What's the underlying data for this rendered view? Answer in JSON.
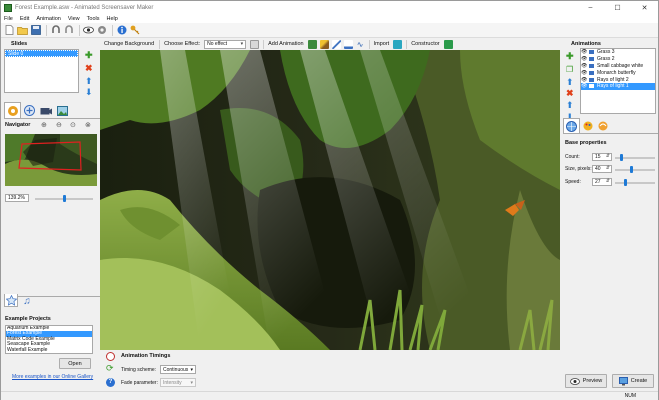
{
  "window": {
    "title": "Forest Example.asw - Animated Screensaver Maker",
    "min": "–",
    "max": "☐",
    "close": "✕"
  },
  "menu": [
    "File",
    "Edit",
    "Animation",
    "View",
    "Tools",
    "Help"
  ],
  "action_bar": {
    "change_background": "Change Background",
    "choose_effect_label": "Choose Effect:",
    "effect_value": "No effect",
    "add_animation": "Add Animation",
    "import": "Import",
    "constructor": "Constructor"
  },
  "slides": {
    "header": "Slides",
    "items": [
      "Slide 0"
    ]
  },
  "navigator": {
    "header": "Navigator",
    "zoom": "139.2%",
    "zoom_fraction": 0.5
  },
  "example_projects": {
    "header": "Example Projects",
    "items": [
      "Aquarium Example",
      "Forest Example",
      "Matrix Code Example",
      "Seascape Example",
      "Waterfall Example"
    ],
    "selected": 1,
    "open_label": "Open",
    "link": "More examples in our Online Gallery"
  },
  "animations": {
    "header": "Animations",
    "items": [
      "Grass 3",
      "Grass 2",
      "Small cabbage white",
      "Monarch butterfly",
      "Rays of light 2",
      "Rays of light 1"
    ],
    "selected": 5
  },
  "base_properties": {
    "header": "Base properties",
    "count_label": "Count:",
    "count": "15",
    "size_label": "Size, pixels:",
    "size": "40",
    "speed_label": "Speed:",
    "speed": "27",
    "count_fraction": 0.15,
    "size_fraction": 0.4,
    "speed_fraction": 0.27
  },
  "timings": {
    "header": "Animation Timings",
    "scheme_label": "Timing scheme:",
    "scheme_value": "Continuous",
    "fade_label": "Fade parameter:",
    "fade_value": "Intensity"
  },
  "buttons": {
    "preview": "Preview",
    "create": "Create"
  },
  "status": {
    "num": "NUM"
  },
  "colors": {
    "accent": "#3399ff",
    "link": "#1a55c8",
    "add": "#3a9a2a",
    "delete": "#e0401a",
    "arrow": "#2a7fd4"
  }
}
